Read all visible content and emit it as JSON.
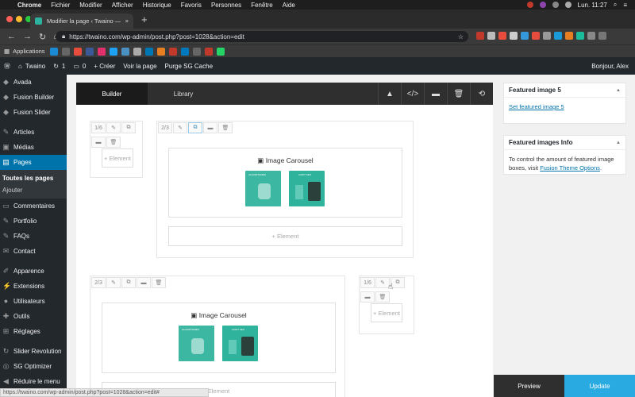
{
  "macbar": {
    "app": "Chrome",
    "menus": [
      "Fichier",
      "Modifier",
      "Afficher",
      "Historique",
      "Favoris",
      "Personnes",
      "Fenêtre",
      "Aide"
    ],
    "clock": "Lun. 11:27"
  },
  "tab": {
    "title": "Modifier la page ‹ Twaino — W",
    "newtab": "+"
  },
  "address": {
    "url": "https://twaino.com/wp-admin/post.php?post=1028&action=edit"
  },
  "bookmarks": {
    "apps": "Applications"
  },
  "adminbar": {
    "site": "Twaino",
    "updates": "1",
    "comments": "0",
    "create": "+ Créer",
    "view": "Voir la page",
    "purge": "Purge SG Cache",
    "greeting": "Bonjour, Alex"
  },
  "sidebar": {
    "items": [
      {
        "label": "Avada",
        "icon": "avada-icon"
      },
      {
        "label": "Fusion Builder",
        "icon": "fusion-builder-icon"
      },
      {
        "label": "Fusion Slider",
        "icon": "fusion-slider-icon"
      },
      {
        "label": "Articles",
        "icon": "pin-icon"
      },
      {
        "label": "Médias",
        "icon": "media-icon"
      },
      {
        "label": "Pages",
        "icon": "pages-icon"
      },
      {
        "label": "Commentaires",
        "icon": "comments-icon"
      },
      {
        "label": "Portfolio",
        "icon": "portfolio-icon"
      },
      {
        "label": "FAQs",
        "icon": "faq-icon"
      },
      {
        "label": "Contact",
        "icon": "contact-icon"
      },
      {
        "label": "Apparence",
        "icon": "brush-icon"
      },
      {
        "label": "Extensions",
        "icon": "plugin-icon"
      },
      {
        "label": "Utilisateurs",
        "icon": "users-icon"
      },
      {
        "label": "Outils",
        "icon": "tools-icon"
      },
      {
        "label": "Réglages",
        "icon": "settings-icon"
      },
      {
        "label": "Slider Revolution",
        "icon": "slider-icon"
      },
      {
        "label": "SG Optimizer",
        "icon": "sg-icon"
      },
      {
        "label": "Réduire le menu",
        "icon": "collapse-icon"
      }
    ],
    "submenu": [
      "Toutes les pages",
      "Ajouter"
    ]
  },
  "builder": {
    "tab_builder": "Builder",
    "tab_library": "Library"
  },
  "canvas": {
    "col1_size": "1/6",
    "col2_size": "2/3",
    "col3_size": "2/3",
    "col4_size": "1/6",
    "element": "Element",
    "add_element": "+ Element",
    "carousel_title": "Image Carousel",
    "thumb1_text": "ALGORITHMES",
    "thumb2_text": "AUDIT SEO"
  },
  "panel": {
    "featured5_title": "Featured image 5",
    "featured5_link": "Set featured image 5",
    "info_title": "Featured images Info",
    "info_text": "To control the amount of featured image boxes, visit",
    "info_link": "Fusion Theme Options",
    "info_end": "."
  },
  "actions": {
    "preview": "Preview",
    "update": "Update"
  },
  "status": {
    "url": "https://twaino.com/wp-admin/post.php?post=1028&action=edit#"
  }
}
